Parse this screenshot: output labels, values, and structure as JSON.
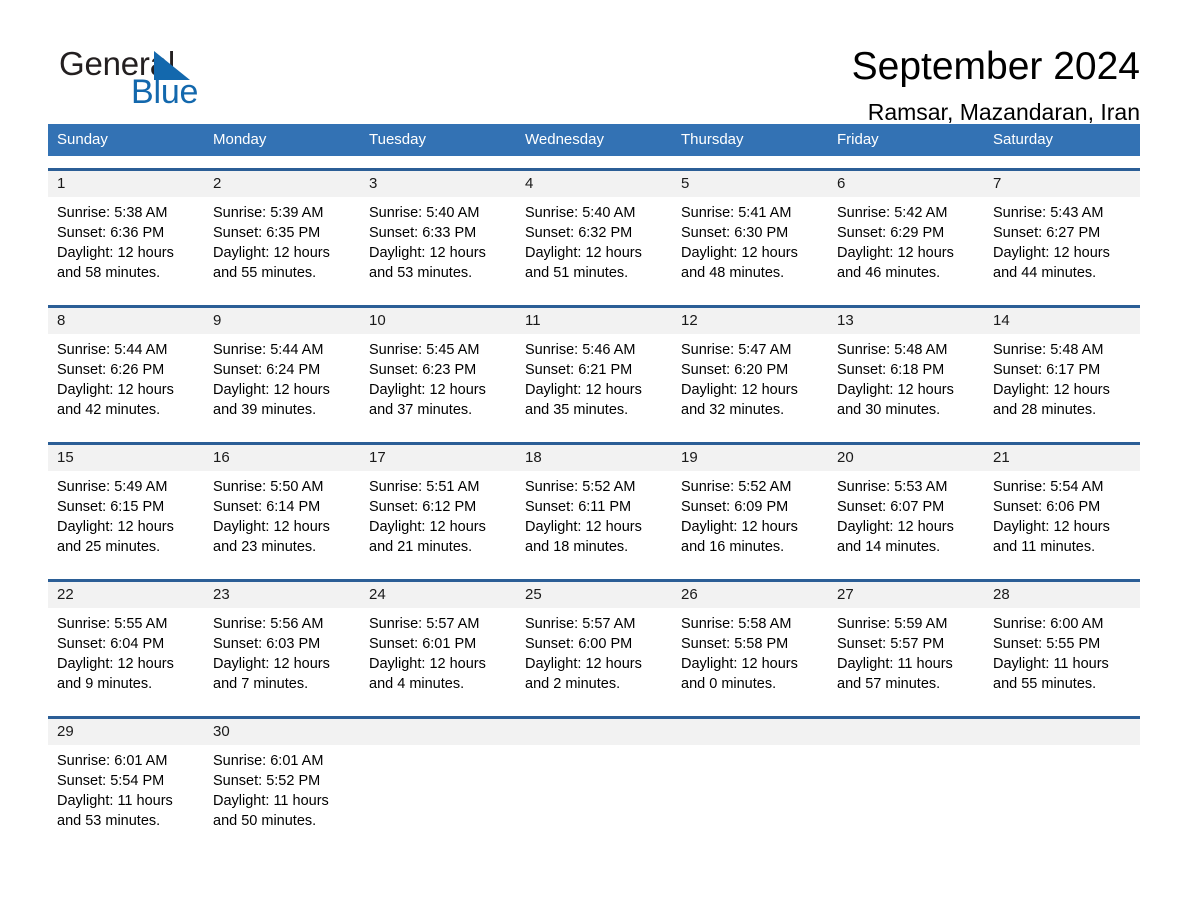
{
  "brand": {
    "word_one": "General",
    "word_two": "Blue",
    "triangle_icon": "triangle-icon",
    "accent_color": "#1368ad"
  },
  "header": {
    "title": "September 2024",
    "subtitle": "Ramsar, Mazandaran, Iran",
    "header_bg_color": "#3372b4",
    "row_divider_color": "#2b5e96",
    "daynum_band_color": "#f2f2f2"
  },
  "weekdays": [
    "Sunday",
    "Monday",
    "Tuesday",
    "Wednesday",
    "Thursday",
    "Friday",
    "Saturday"
  ],
  "weeks": [
    {
      "days": [
        {
          "num": "1",
          "sunrise": "Sunrise: 5:38 AM",
          "sunset": "Sunset: 6:36 PM",
          "daylight_1": "Daylight: 12 hours",
          "daylight_2": "and 58 minutes."
        },
        {
          "num": "2",
          "sunrise": "Sunrise: 5:39 AM",
          "sunset": "Sunset: 6:35 PM",
          "daylight_1": "Daylight: 12 hours",
          "daylight_2": "and 55 minutes."
        },
        {
          "num": "3",
          "sunrise": "Sunrise: 5:40 AM",
          "sunset": "Sunset: 6:33 PM",
          "daylight_1": "Daylight: 12 hours",
          "daylight_2": "and 53 minutes."
        },
        {
          "num": "4",
          "sunrise": "Sunrise: 5:40 AM",
          "sunset": "Sunset: 6:32 PM",
          "daylight_1": "Daylight: 12 hours",
          "daylight_2": "and 51 minutes."
        },
        {
          "num": "5",
          "sunrise": "Sunrise: 5:41 AM",
          "sunset": "Sunset: 6:30 PM",
          "daylight_1": "Daylight: 12 hours",
          "daylight_2": "and 48 minutes."
        },
        {
          "num": "6",
          "sunrise": "Sunrise: 5:42 AM",
          "sunset": "Sunset: 6:29 PM",
          "daylight_1": "Daylight: 12 hours",
          "daylight_2": "and 46 minutes."
        },
        {
          "num": "7",
          "sunrise": "Sunrise: 5:43 AM",
          "sunset": "Sunset: 6:27 PM",
          "daylight_1": "Daylight: 12 hours",
          "daylight_2": "and 44 minutes."
        }
      ]
    },
    {
      "days": [
        {
          "num": "8",
          "sunrise": "Sunrise: 5:44 AM",
          "sunset": "Sunset: 6:26 PM",
          "daylight_1": "Daylight: 12 hours",
          "daylight_2": "and 42 minutes."
        },
        {
          "num": "9",
          "sunrise": "Sunrise: 5:44 AM",
          "sunset": "Sunset: 6:24 PM",
          "daylight_1": "Daylight: 12 hours",
          "daylight_2": "and 39 minutes."
        },
        {
          "num": "10",
          "sunrise": "Sunrise: 5:45 AM",
          "sunset": "Sunset: 6:23 PM",
          "daylight_1": "Daylight: 12 hours",
          "daylight_2": "and 37 minutes."
        },
        {
          "num": "11",
          "sunrise": "Sunrise: 5:46 AM",
          "sunset": "Sunset: 6:21 PM",
          "daylight_1": "Daylight: 12 hours",
          "daylight_2": "and 35 minutes."
        },
        {
          "num": "12",
          "sunrise": "Sunrise: 5:47 AM",
          "sunset": "Sunset: 6:20 PM",
          "daylight_1": "Daylight: 12 hours",
          "daylight_2": "and 32 minutes."
        },
        {
          "num": "13",
          "sunrise": "Sunrise: 5:48 AM",
          "sunset": "Sunset: 6:18 PM",
          "daylight_1": "Daylight: 12 hours",
          "daylight_2": "and 30 minutes."
        },
        {
          "num": "14",
          "sunrise": "Sunrise: 5:48 AM",
          "sunset": "Sunset: 6:17 PM",
          "daylight_1": "Daylight: 12 hours",
          "daylight_2": "and 28 minutes."
        }
      ]
    },
    {
      "days": [
        {
          "num": "15",
          "sunrise": "Sunrise: 5:49 AM",
          "sunset": "Sunset: 6:15 PM",
          "daylight_1": "Daylight: 12 hours",
          "daylight_2": "and 25 minutes."
        },
        {
          "num": "16",
          "sunrise": "Sunrise: 5:50 AM",
          "sunset": "Sunset: 6:14 PM",
          "daylight_1": "Daylight: 12 hours",
          "daylight_2": "and 23 minutes."
        },
        {
          "num": "17",
          "sunrise": "Sunrise: 5:51 AM",
          "sunset": "Sunset: 6:12 PM",
          "daylight_1": "Daylight: 12 hours",
          "daylight_2": "and 21 minutes."
        },
        {
          "num": "18",
          "sunrise": "Sunrise: 5:52 AM",
          "sunset": "Sunset: 6:11 PM",
          "daylight_1": "Daylight: 12 hours",
          "daylight_2": "and 18 minutes."
        },
        {
          "num": "19",
          "sunrise": "Sunrise: 5:52 AM",
          "sunset": "Sunset: 6:09 PM",
          "daylight_1": "Daylight: 12 hours",
          "daylight_2": "and 16 minutes."
        },
        {
          "num": "20",
          "sunrise": "Sunrise: 5:53 AM",
          "sunset": "Sunset: 6:07 PM",
          "daylight_1": "Daylight: 12 hours",
          "daylight_2": "and 14 minutes."
        },
        {
          "num": "21",
          "sunrise": "Sunrise: 5:54 AM",
          "sunset": "Sunset: 6:06 PM",
          "daylight_1": "Daylight: 12 hours",
          "daylight_2": "and 11 minutes."
        }
      ]
    },
    {
      "days": [
        {
          "num": "22",
          "sunrise": "Sunrise: 5:55 AM",
          "sunset": "Sunset: 6:04 PM",
          "daylight_1": "Daylight: 12 hours",
          "daylight_2": "and 9 minutes."
        },
        {
          "num": "23",
          "sunrise": "Sunrise: 5:56 AM",
          "sunset": "Sunset: 6:03 PM",
          "daylight_1": "Daylight: 12 hours",
          "daylight_2": "and 7 minutes."
        },
        {
          "num": "24",
          "sunrise": "Sunrise: 5:57 AM",
          "sunset": "Sunset: 6:01 PM",
          "daylight_1": "Daylight: 12 hours",
          "daylight_2": "and 4 minutes."
        },
        {
          "num": "25",
          "sunrise": "Sunrise: 5:57 AM",
          "sunset": "Sunset: 6:00 PM",
          "daylight_1": "Daylight: 12 hours",
          "daylight_2": "and 2 minutes."
        },
        {
          "num": "26",
          "sunrise": "Sunrise: 5:58 AM",
          "sunset": "Sunset: 5:58 PM",
          "daylight_1": "Daylight: 12 hours",
          "daylight_2": "and 0 minutes."
        },
        {
          "num": "27",
          "sunrise": "Sunrise: 5:59 AM",
          "sunset": "Sunset: 5:57 PM",
          "daylight_1": "Daylight: 11 hours",
          "daylight_2": "and 57 minutes."
        },
        {
          "num": "28",
          "sunrise": "Sunrise: 6:00 AM",
          "sunset": "Sunset: 5:55 PM",
          "daylight_1": "Daylight: 11 hours",
          "daylight_2": "and 55 minutes."
        }
      ]
    },
    {
      "days": [
        {
          "num": "29",
          "sunrise": "Sunrise: 6:01 AM",
          "sunset": "Sunset: 5:54 PM",
          "daylight_1": "Daylight: 11 hours",
          "daylight_2": "and 53 minutes."
        },
        {
          "num": "30",
          "sunrise": "Sunrise: 6:01 AM",
          "sunset": "Sunset: 5:52 PM",
          "daylight_1": "Daylight: 11 hours",
          "daylight_2": "and 50 minutes."
        },
        {
          "num": "",
          "sunrise": "",
          "sunset": "",
          "daylight_1": "",
          "daylight_2": ""
        },
        {
          "num": "",
          "sunrise": "",
          "sunset": "",
          "daylight_1": "",
          "daylight_2": ""
        },
        {
          "num": "",
          "sunrise": "",
          "sunset": "",
          "daylight_1": "",
          "daylight_2": ""
        },
        {
          "num": "",
          "sunrise": "",
          "sunset": "",
          "daylight_1": "",
          "daylight_2": ""
        },
        {
          "num": "",
          "sunrise": "",
          "sunset": "",
          "daylight_1": "",
          "daylight_2": ""
        }
      ]
    }
  ]
}
